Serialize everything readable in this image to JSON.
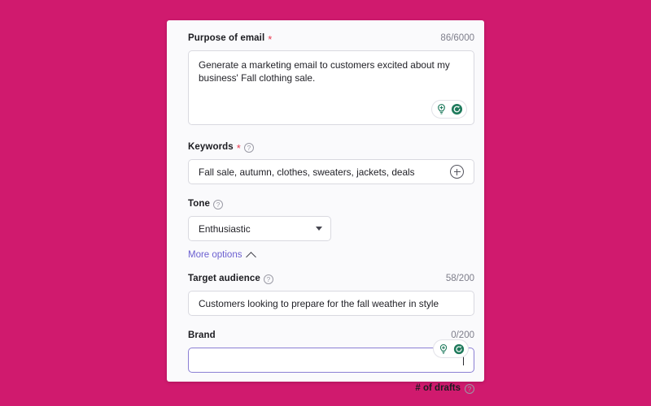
{
  "theme": {
    "page_background": "#d01a6e",
    "card_background": "#fafafc",
    "accent_link": "#6b5fd0",
    "required_marker": "#e8384f",
    "icon_green": "#1f7a5c",
    "focus_border": "#8b7fd4"
  },
  "form": {
    "purpose": {
      "label": "Purpose of email",
      "required_marker": "*",
      "counter": "86/6000",
      "value": "Generate a marketing email to customers excited about my business' Fall clothing sale.",
      "actions": [
        "lightbulb-plus-icon",
        "regenerate-icon"
      ]
    },
    "keywords": {
      "label": "Keywords",
      "required_marker": "*",
      "help": "?",
      "value": "Fall sale, autumn, clothes, sweaters, jackets, deals",
      "add_icon": "plus-circle-icon"
    },
    "tone": {
      "label": "Tone",
      "help": "?",
      "selected": "Enthusiastic",
      "options": [
        "Enthusiastic"
      ]
    },
    "more_options": {
      "label": "More options",
      "chevron": "chevron-up-icon",
      "expanded": true
    },
    "target_audience": {
      "label": "Target audience",
      "help": "?",
      "counter": "58/200",
      "value": "Customers looking to prepare for the fall weather in style"
    },
    "brand": {
      "label": "Brand",
      "counter": "0/200",
      "value": "",
      "placeholder": "",
      "focused": true,
      "actions": [
        "lightbulb-plus-icon",
        "regenerate-icon"
      ]
    },
    "drafts": {
      "label": "# of drafts",
      "help": "?"
    }
  }
}
